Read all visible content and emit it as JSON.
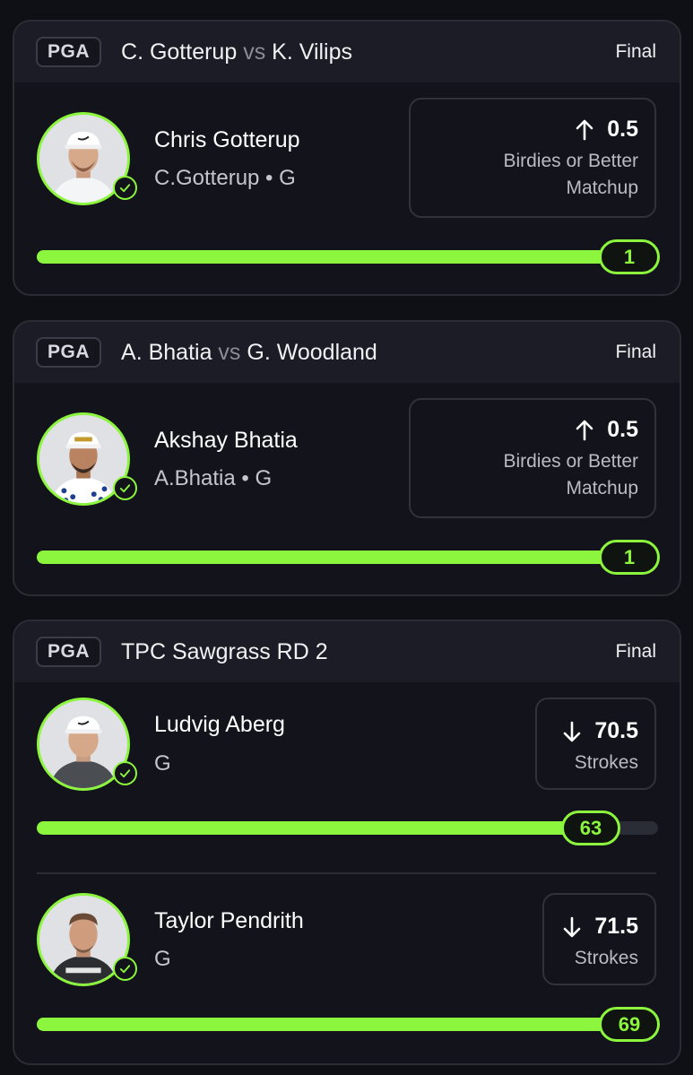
{
  "colors": {
    "accent": "#8cf53d",
    "card_bg": "#12131b",
    "header_bg": "#1b1c25"
  },
  "cards": [
    {
      "league": "PGA",
      "title_left": "C. Gotterup",
      "title_vs": "vs",
      "title_right": "K. Vilips",
      "status": "Final",
      "players": [
        {
          "name": "Chris Gotterup",
          "sub": "C.Gotterup • G",
          "direction": "up",
          "line": "0.5",
          "stat_line1": "Birdies or Better",
          "stat_line2": "Matchup",
          "result": "1",
          "progress": 1.0
        }
      ]
    },
    {
      "league": "PGA",
      "title_left": "A. Bhatia",
      "title_vs": "vs",
      "title_right": "G. Woodland",
      "status": "Final",
      "players": [
        {
          "name": "Akshay Bhatia",
          "sub": "A.Bhatia • G",
          "direction": "up",
          "line": "0.5",
          "stat_line1": "Birdies or Better",
          "stat_line2": "Matchup",
          "result": "1",
          "progress": 1.0
        }
      ]
    },
    {
      "league": "PGA",
      "title_left": "TPC Sawgrass RD 2",
      "title_vs": "",
      "title_right": "",
      "status": "Final",
      "players": [
        {
          "name": "Ludvig Aberg",
          "sub": "G",
          "direction": "down",
          "line": "70.5",
          "stat_line1": "Strokes",
          "result": "63",
          "progress": 0.89
        },
        {
          "name": "Taylor Pendrith",
          "sub": "G",
          "direction": "down",
          "line": "71.5",
          "stat_line1": "Strokes",
          "result": "69",
          "progress": 1.0
        }
      ]
    }
  ]
}
